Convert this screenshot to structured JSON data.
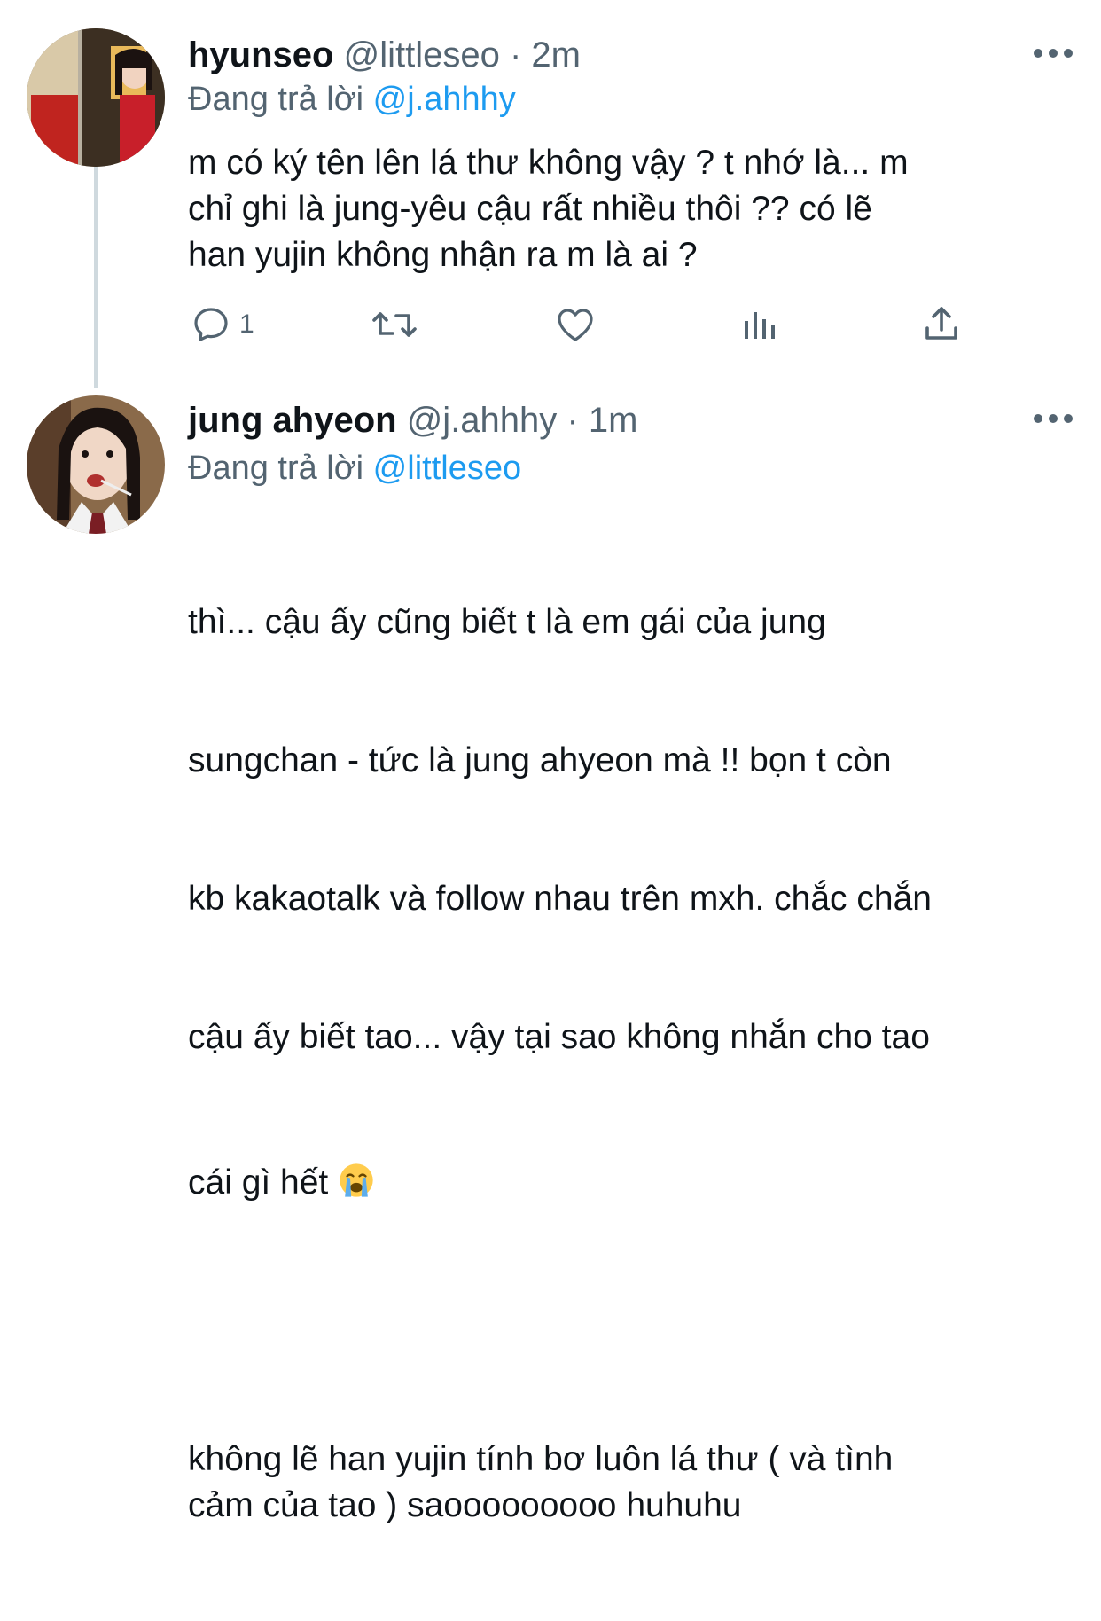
{
  "tweets": [
    {
      "display_name": "hyunseo",
      "handle": "@littleseo",
      "separator": "·",
      "time": "2m",
      "reply_prefix": "Đang trả lời",
      "reply_to": "@j.ahhhy",
      "text": "m có ký tên lên lá thư không vậy ? t nhớ là... m\nchỉ ghi là jung-yêu cậu rất nhiều thôi ?? có lẽ\nhan yujin không nhận ra m là ai ?",
      "reply_count": "1"
    },
    {
      "display_name": "jung ahyeon",
      "handle": "@j.ahhhy",
      "separator": "·",
      "time": "1m",
      "reply_prefix": "Đang trả lời",
      "reply_to": "@littleseo",
      "text_line_1": "thì... cậu ấy cũng biết t là em gái của jung",
      "text_line_2": "sungchan - tức là jung ahyeon mà !! bọn t còn",
      "text_line_3": "kb kakaotalk và follow nhau trên mxh. chắc chắn",
      "text_line_4": "cậu ấy biết tao... vậy tại sao không nhắn cho tao",
      "text_line_5": "cái gì hết",
      "emoji": "loudly-crying-face",
      "text_paragraph_2": "không lẽ han yujin tính bơ luôn lá thư ( và tình\ncảm của tao ) saooooooooo huhuhu"
    }
  ],
  "icons": {
    "reply": "reply-icon",
    "retweet": "retweet-icon",
    "like": "heart-icon",
    "analytics": "analytics-icon",
    "share": "share-icon",
    "more": "more-icon"
  },
  "colors": {
    "text": "#0f1419",
    "secondary": "#536471",
    "link": "#1d9bf0",
    "thread_line": "#cfd9de"
  }
}
